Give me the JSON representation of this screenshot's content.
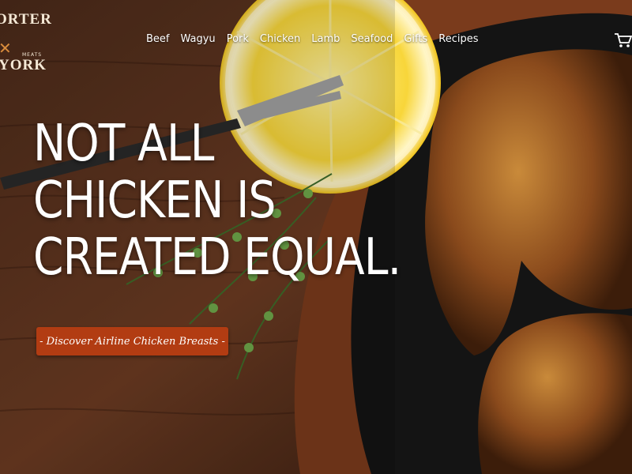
{
  "logo": {
    "top_text": "ORTER",
    "bottom_text": "YORK",
    "meats_text": "MEATS",
    "accent_color": "#d98c3c"
  },
  "nav": {
    "items": [
      {
        "label": "Beef"
      },
      {
        "label": "Wagyu"
      },
      {
        "label": "Pork"
      },
      {
        "label": "Chicken"
      },
      {
        "label": "Lamb"
      },
      {
        "label": "Seafood"
      },
      {
        "label": "Gifts"
      },
      {
        "label": "Recipes"
      }
    ],
    "cart_icon": "cart-icon"
  },
  "hero": {
    "headline_lines": [
      "NOT ALL",
      "CHICKEN IS",
      "CREATED EQUAL."
    ],
    "cta_label": "- Discover Airline Chicken Breasts -",
    "cta_color": "#b23c12"
  }
}
